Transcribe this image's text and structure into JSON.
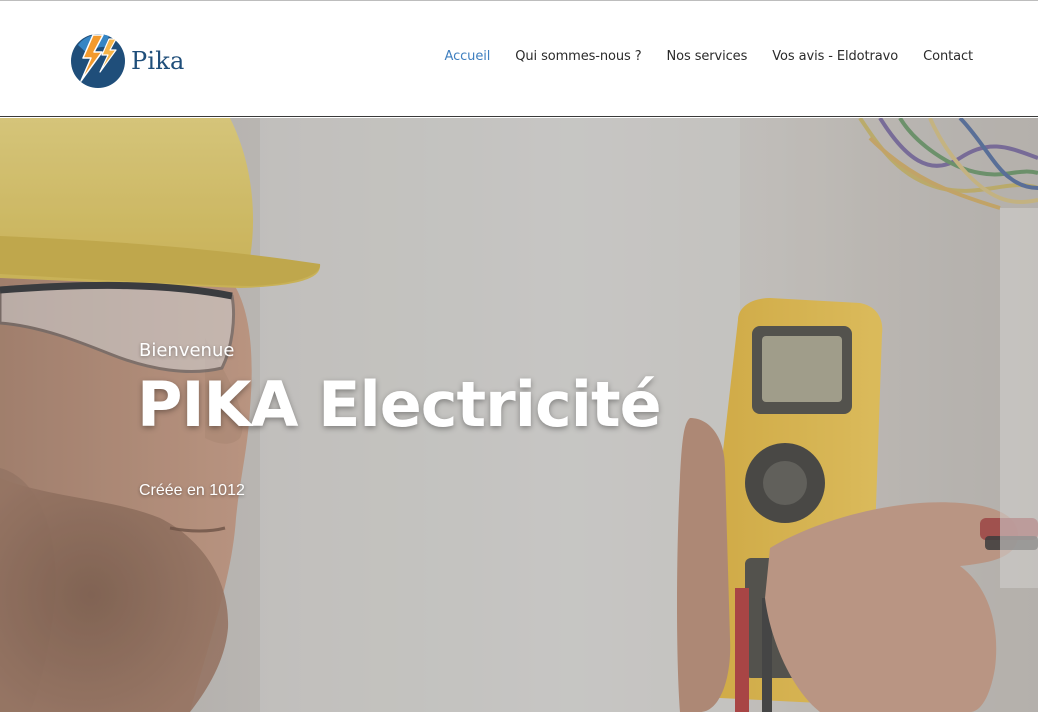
{
  "header": {
    "logo_text": "Pika",
    "logo_icon": "lightning-logo-icon"
  },
  "nav": {
    "items": [
      {
        "label": "Accueil",
        "active": true
      },
      {
        "label": "Qui sommes-nous ?",
        "active": false
      },
      {
        "label": "Nos services",
        "active": false
      },
      {
        "label": "Vos avis - Eldotravo",
        "active": false
      },
      {
        "label": "Contact",
        "active": false
      }
    ]
  },
  "hero": {
    "kicker": "Bienvenue",
    "title": "PIKA Electricité",
    "subtitle": "Créée en 1012",
    "background": "electrician-multimeter-photo"
  },
  "colors": {
    "brand_blue": "#1f4e7a",
    "accent_orange": "#f29a2e",
    "nav_active": "#3f7fbf",
    "nav_text": "#2b2b2b",
    "hero_text": "#ffffff"
  }
}
